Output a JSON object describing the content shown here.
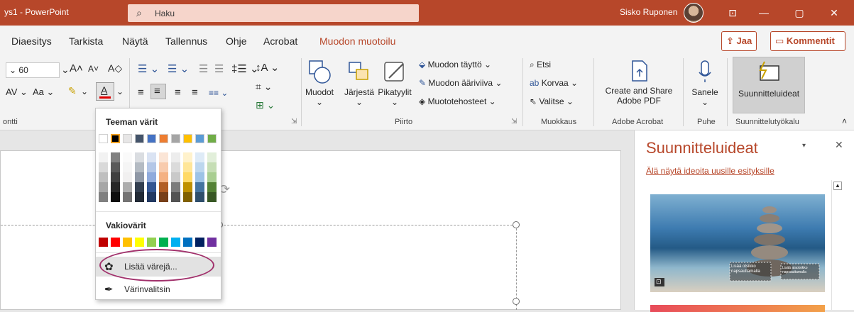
{
  "titlebar": {
    "app_title": "ys1  -  PowerPoint",
    "search_placeholder": "Haku",
    "user_name": "Sisko Ruponen",
    "minimize": "—",
    "restore": "▢",
    "close": "✕",
    "ribbon_display": "⊡"
  },
  "menubar": {
    "tabs": [
      "Diaesitys",
      "Tarkista",
      "Näytä",
      "Tallennus",
      "Ohje",
      "Acrobat",
      "Muodon muotoilu"
    ],
    "share": "Jaa",
    "comments": "Kommentit"
  },
  "ribbon": {
    "font": {
      "size": "60",
      "group_label": "ontti"
    },
    "drawing": {
      "shapes": "Muodot",
      "arrange": "Järjestä",
      "quick_styles": "Pikatyylit",
      "fill": "Muodon täyttö",
      "outline": "Muodon ääriviiva",
      "effects": "Muototehosteet",
      "group_label": "Piirto"
    },
    "editing": {
      "find": "Etsi",
      "replace": "Korvaa",
      "select": "Valitse",
      "group_label": "Muokkaus"
    },
    "acrobat": {
      "create_share_line1": "Create and Share",
      "create_share_line2": "Adobe PDF",
      "group_label": "Adobe Acrobat"
    },
    "voice": {
      "dictate": "Sanele",
      "group_label": "Puhe"
    },
    "designer": {
      "ideas": "Suunnitteluideat",
      "group_label": "Suunnittelutyökalu"
    }
  },
  "pane": {
    "title": "Suunnitteluideat",
    "link": "Älä näytä ideoita uusille esityksille",
    "card_text1": "Lisää otsikko napsauttamalla",
    "card_text2": "Lisää alaotsikko napsauttamalla"
  },
  "color_menu": {
    "theme_heading": "Teeman värit",
    "standard_heading": "Vakiovärit",
    "more_colors": "Lisää värejä...",
    "eyedropper": "Värinvalitsin",
    "theme_colors": [
      "#ffffff",
      "#000000",
      "#e7e6e6",
      "#44546a",
      "#4472c4",
      "#ed7d31",
      "#a5a5a5",
      "#ffc000",
      "#5b9bd5",
      "#70ad47"
    ],
    "standard_colors": [
      "#c00000",
      "#ff0000",
      "#ffc000",
      "#ffff00",
      "#92d050",
      "#00b050",
      "#00b0f0",
      "#0070c0",
      "#002060",
      "#7030a0"
    ]
  }
}
